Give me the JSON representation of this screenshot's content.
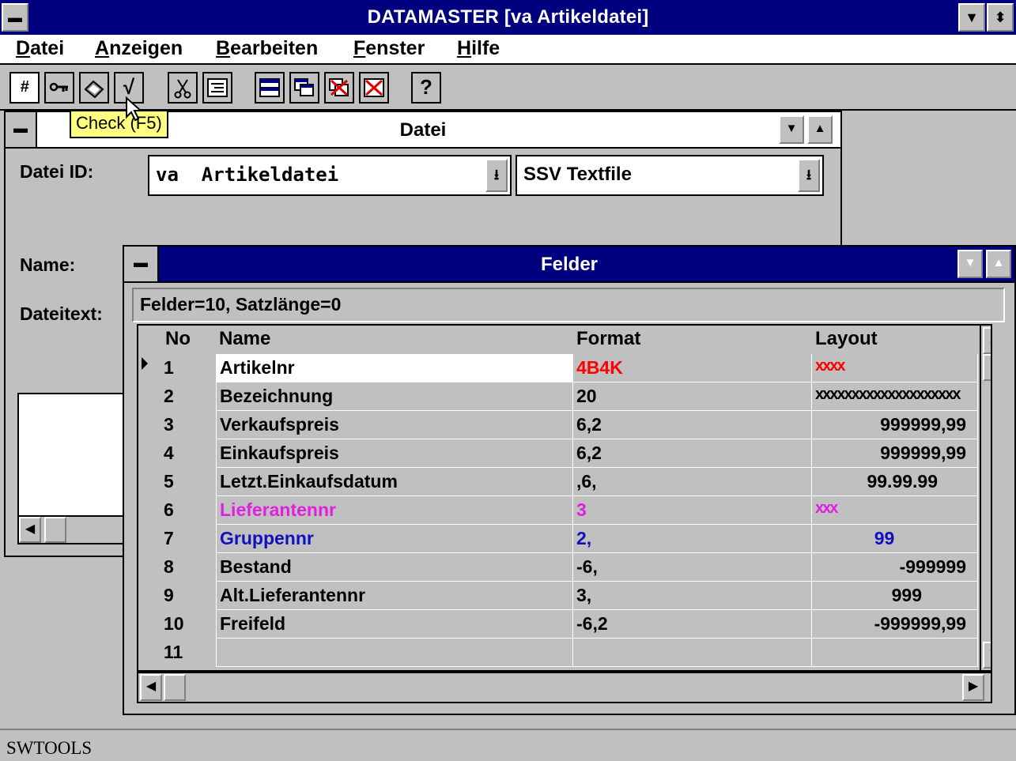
{
  "app": {
    "title": "DATAMASTER [va Artikeldatei]",
    "menu": [
      "Datei",
      "Anzeigen",
      "Bearbeiten",
      "Fenster",
      "Hilfe"
    ]
  },
  "toolbar": {
    "buttons": [
      "hash-icon",
      "key-icon",
      "eraser-icon",
      "check-icon",
      "cut-icon",
      "list-icon",
      "tile-icon",
      "cascade-icon",
      "delete-icon",
      "close-all-icon",
      "help-icon"
    ],
    "hash_label": "#",
    "check_label": "√",
    "help_label": "?",
    "tooltip": "Check (F5)"
  },
  "datei_window": {
    "title": "Datei",
    "datei_id_label": "Datei ID:",
    "name_label": "Name:",
    "dateitext_label": "Dateitext:",
    "datei_id_value": "va  Artikeldatei",
    "filetype_value": "SSV Textfile"
  },
  "felder_window": {
    "title": "Felder",
    "info": "Felder=10, Satzlänge=0",
    "columns": {
      "no": "No",
      "name": "Name",
      "format": "Format",
      "layout": "Layout"
    },
    "rows": [
      {
        "no": "1",
        "name": "Artikelnr",
        "format": "4B4K",
        "layout": "xxxx"
      },
      {
        "no": "2",
        "name": "Bezeichnung",
        "format": "20",
        "layout": "xxxxxxxxxxxxxxxxxxxx"
      },
      {
        "no": "3",
        "name": "Verkaufspreis",
        "format": "6,2",
        "layout": "999999,99"
      },
      {
        "no": "4",
        "name": "Einkaufspreis",
        "format": "6,2",
        "layout": "999999,99"
      },
      {
        "no": "5",
        "name": "Letzt.Einkaufsdatum",
        "format": ",6,",
        "layout": "99.99.99"
      },
      {
        "no": "6",
        "name": "Lieferantennr",
        "format": "3",
        "layout": "xxx"
      },
      {
        "no": "7",
        "name": "Gruppennr",
        "format": "2,",
        "layout": "99"
      },
      {
        "no": "8",
        "name": "Bestand",
        "format": "-6,",
        "layout": "-999999"
      },
      {
        "no": "9",
        "name": "Alt.Lieferantennr",
        "format": "3,",
        "layout": "999"
      },
      {
        "no": "10",
        "name": "Freifeld",
        "format": "-6,2",
        "layout": "-999999,99"
      },
      {
        "no": "11",
        "name": "",
        "format": "",
        "layout": ""
      }
    ]
  },
  "status": {
    "text": "SWTOOLS"
  },
  "colors": {
    "titlebar": "#00007e",
    "error_red": "#ff0000",
    "magenta": "#e020e0",
    "blue": "#1010c0",
    "tooltip": "#ffff80"
  }
}
